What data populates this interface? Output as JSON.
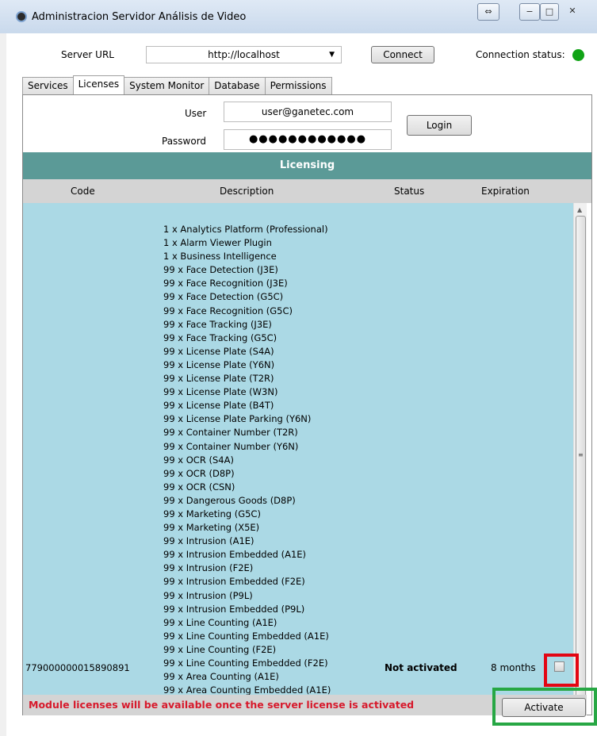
{
  "window": {
    "title": "Administracion Servidor Análisis de Video",
    "controls": {
      "resize": "⇔",
      "minimize": "−",
      "maximize": "□",
      "close": "✕"
    }
  },
  "server": {
    "url_label": "Server URL",
    "url_value": "http://localhost",
    "connect_label": "Connect",
    "status_label": "Connection status:",
    "status_color": "#11a316"
  },
  "tabs": [
    {
      "label": "Services",
      "active": false
    },
    {
      "label": "Licenses",
      "active": true
    },
    {
      "label": "System Monitor",
      "active": false
    },
    {
      "label": "Database",
      "active": false
    },
    {
      "label": "Permissions",
      "active": false
    }
  ],
  "login": {
    "user_label": "User",
    "user_value": "user@ganetec.com",
    "password_label": "Password",
    "password_value": "●●●●●●●●●●●●",
    "login_label": "Login"
  },
  "licensing": {
    "header": "Licensing",
    "columns": {
      "code": "Code",
      "description": "Description",
      "status": "Status",
      "expiration": "Expiration"
    },
    "row": {
      "code": "779000000015890891",
      "status": "Not activated",
      "expiration": "8 months",
      "checked": false
    },
    "description_lines": [
      "1  x  Analytics Platform (Professional)",
      "1  x  Alarm Viewer Plugin",
      "1  x  Business Intelligence",
      "99  x  Face Detection (J3E)",
      "99  x  Face Recognition (J3E)",
      "99  x  Face Detection (G5C)",
      "99  x  Face Recognition (G5C)",
      "99  x  Face Tracking (J3E)",
      "99  x  Face Tracking (G5C)",
      "99  x  License Plate (S4A)",
      "99  x  License Plate (Y6N)",
      "99  x  License Plate (T2R)",
      "99  x  License Plate (W3N)",
      "99  x  License Plate (B4T)",
      "99  x  License Plate Parking (Y6N)",
      "99  x  Container Number (T2R)",
      "99  x  Container Number (Y6N)",
      "99  x  OCR (S4A)",
      "99  x  OCR (D8P)",
      "99  x  OCR (CSN)",
      "99  x  Dangerous Goods (D8P)",
      "99  x  Marketing (G5C)",
      "99  x  Marketing (X5E)",
      "99  x  Intrusion (A1E)",
      "99  x  Intrusion Embedded (A1E)",
      "99  x  Intrusion (F2E)",
      "99  x  Intrusion Embedded (F2E)",
      "99  x  Intrusion (P9L)",
      "99  x  Intrusion Embedded (P9L)",
      "99  x  Line Counting (A1E)",
      "99  x  Line Counting Embedded (A1E)",
      "99  x  Line Counting (F2E)",
      "99  x  Line Counting Embedded (F2E)",
      "99  x  Area Counting (A1E)",
      "99  x  Area Counting Embedded (A1E)"
    ]
  },
  "footer": {
    "message": "Module licenses will be available once the server license is activated",
    "activate_label": "Activate"
  },
  "colors": {
    "header_bar": "#5b9a97",
    "list_background": "#abd9e5",
    "footer_message": "#d7192b",
    "highlight_red": "#e30613",
    "highlight_green": "#27a744"
  }
}
